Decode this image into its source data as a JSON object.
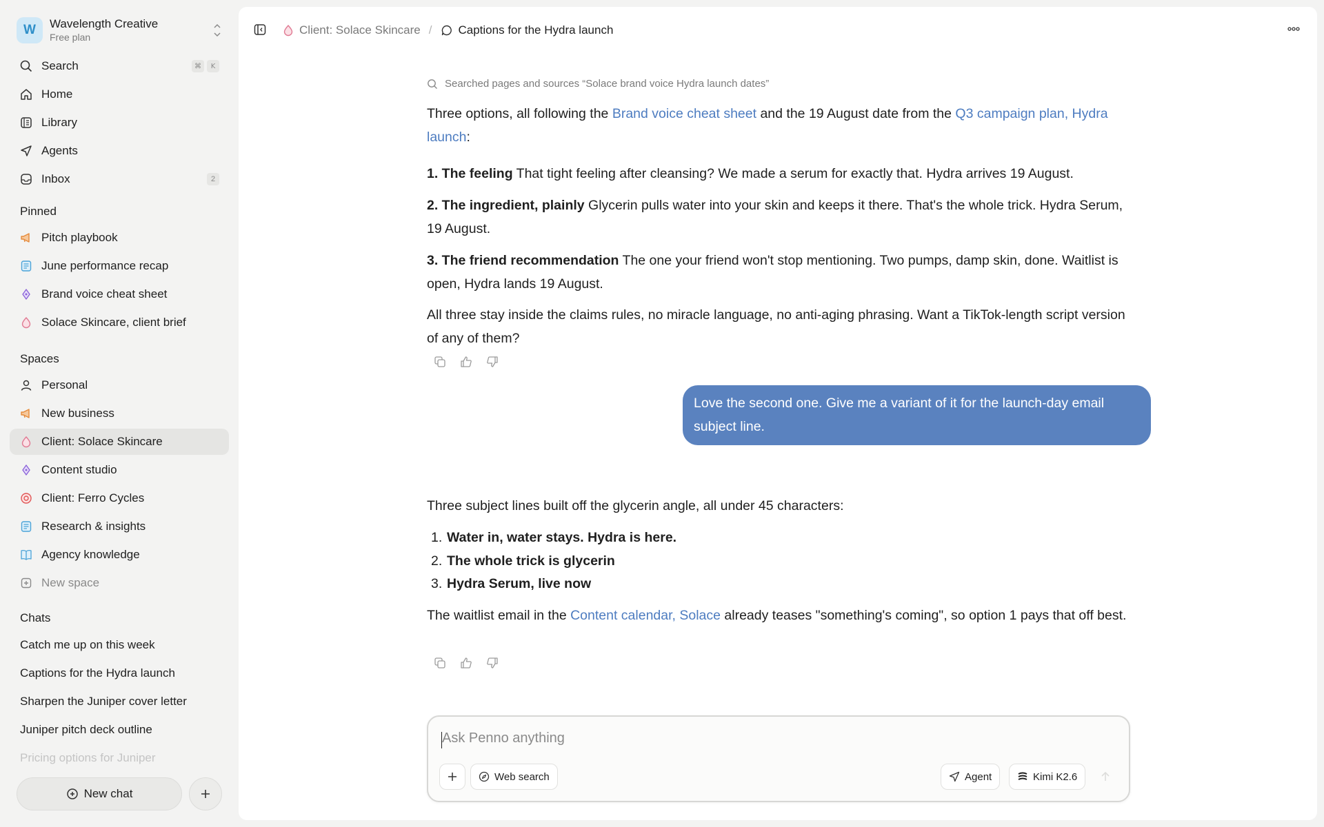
{
  "workspace": {
    "initial": "W",
    "name": "Wavelength Creative",
    "plan": "Free plan"
  },
  "nav": [
    {
      "label": "Search",
      "icon": "search-icon",
      "shortcut": [
        "⌘",
        "K"
      ]
    },
    {
      "label": "Home",
      "icon": "home-icon"
    },
    {
      "label": "Library",
      "icon": "library-icon"
    },
    {
      "label": "Agents",
      "icon": "agents-icon"
    },
    {
      "label": "Inbox",
      "icon": "inbox-icon",
      "count": "2"
    }
  ],
  "pinned": {
    "title": "Pinned",
    "items": [
      {
        "label": "Pitch playbook",
        "icon": "megaphone-icon"
      },
      {
        "label": "June performance recap",
        "icon": "document-icon"
      },
      {
        "label": "Brand voice cheat sheet",
        "icon": "pen-nib-icon"
      },
      {
        "label": "Solace Skincare, client brief",
        "icon": "droplet-icon"
      }
    ]
  },
  "spaces": {
    "title": "Spaces",
    "items": [
      {
        "label": "Personal",
        "icon": "person-icon"
      },
      {
        "label": "New business",
        "icon": "megaphone-icon"
      },
      {
        "label": "Client: Solace Skincare",
        "icon": "droplet-icon",
        "active": true
      },
      {
        "label": "Content studio",
        "icon": "pen-nib-icon"
      },
      {
        "label": "Client: Ferro Cycles",
        "icon": "target-icon"
      },
      {
        "label": "Research & insights",
        "icon": "document-icon"
      },
      {
        "label": "Agency knowledge",
        "icon": "book-icon"
      },
      {
        "label": "New space",
        "icon": "add-space-icon"
      }
    ]
  },
  "chats": {
    "title": "Chats",
    "items": [
      "Catch me up on this week",
      "Captions for the Hydra launch",
      "Sharpen the Juniper cover letter",
      "Juniper pitch deck outline",
      "Pricing options for Juniper"
    ]
  },
  "sidebar_footer": {
    "new_chat": "New chat"
  },
  "breadcrumb": {
    "space": "Client: Solace Skincare",
    "separator": "/",
    "chat": "Captions for the Hydra launch"
  },
  "conversation": {
    "searched": "Searched pages and sources “Solace brand voice Hydra launch dates”",
    "intro": {
      "t1": "Three options, all following the ",
      "link1": "Brand voice cheat sheet",
      "t2": " and the 19 August date from the ",
      "link2": "Q3 campaign plan, Hydra launch",
      "t3": ":"
    },
    "options": [
      {
        "title": "1. The feeling",
        "text": " That tight feeling after cleansing? We made a serum for exactly that. Hydra arrives 19 August."
      },
      {
        "title": "2. The ingredient, plainly",
        "text": " Glycerin pulls water into your skin and keeps it there. That's the whole trick. Hydra Serum, 19 August."
      },
      {
        "title": "3. The friend recommendation",
        "text": " The one your friend won't stop mentioning. Two pumps, damp skin, done. Waitlist is open, Hydra lands 19 August."
      }
    ],
    "closing": "All three stay inside the claims rules, no miracle language, no anti-aging phrasing. Want a TikTok-length script version of any of them?",
    "user_message": "Love the second one. Give me a variant of it for the launch-day email subject line.",
    "reply_intro": "Three subject lines built off the glycerin angle, all under 45 characters:",
    "subject_lines": [
      {
        "num": "1.",
        "text": "Water in, water stays. Hydra is here."
      },
      {
        "num": "2.",
        "text": "The whole trick is glycerin"
      },
      {
        "num": "3.",
        "text": "Hydra Serum, live now"
      }
    ],
    "reply_outro": {
      "t1": "The waitlist email in the ",
      "link": "Content calendar, Solace",
      "t2": " already teases \"something's coming\", so option 1 pays that off best."
    }
  },
  "composer": {
    "placeholder": "Ask Penno anything",
    "web_search": "Web search",
    "agent": "Agent",
    "model": "Kimi K2.6"
  },
  "colors": {
    "accent": "#5a82bf",
    "link": "#4d7cc0",
    "active_bg": "#e5e5e3",
    "background": "#f3f3f2"
  }
}
